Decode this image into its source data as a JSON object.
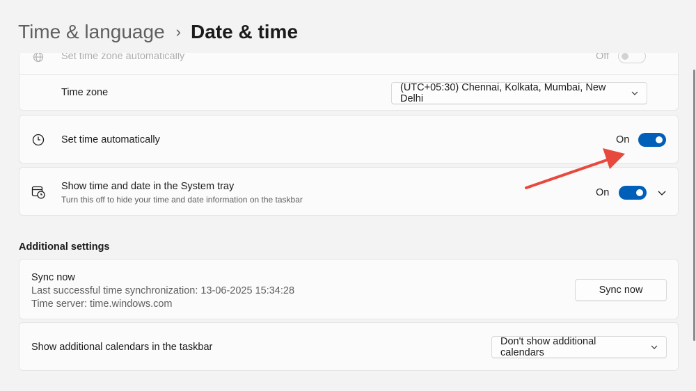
{
  "breadcrumb": {
    "parent": "Time & language",
    "separator": "›",
    "current": "Date & time"
  },
  "timezone_card": {
    "auto_timezone_label": "Set time zone automatically",
    "auto_timezone_state": "Off",
    "timezone_label": "Time zone",
    "timezone_value": "(UTC+05:30) Chennai, Kolkata, Mumbai, New Delhi"
  },
  "set_time_auto": {
    "label": "Set time automatically",
    "state": "On"
  },
  "systray": {
    "label": "Show time and date in the System tray",
    "description": "Turn this off to hide your time and date information on the taskbar",
    "state": "On"
  },
  "additional": {
    "title": "Additional settings",
    "sync": {
      "title": "Sync now",
      "last_sync": "Last successful time synchronization: 13-06-2025 15:34:28",
      "server": "Time server: time.windows.com",
      "button": "Sync now"
    },
    "calendars": {
      "label": "Show additional calendars in the taskbar",
      "value": "Don't show additional calendars"
    }
  },
  "colors": {
    "accent": "#005fb8",
    "annotation_arrow": "#e8493d",
    "background": "#f3f3f3",
    "card": "#fbfbfb"
  },
  "icons": {
    "globe": "globe-icon",
    "clock": "clock-icon",
    "calendar_clock": "calendar-clock-icon",
    "chevron_down": "chevron-down-icon",
    "breadcrumb_chevron": "chevron-right-icon"
  }
}
